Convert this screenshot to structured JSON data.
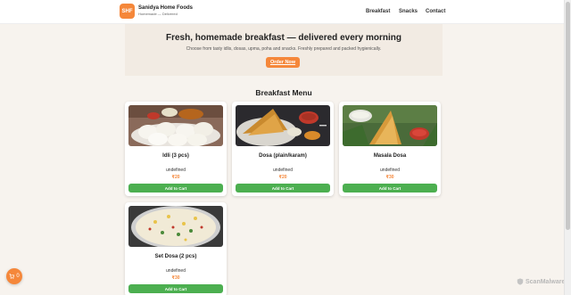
{
  "header": {
    "logo_text": "SHF",
    "brand_name": "Sanidya Home Foods",
    "brand_tagline": "Homemade — Delivered",
    "nav": [
      "Breakfast",
      "Snacks",
      "Contact"
    ]
  },
  "hero": {
    "title": "Fresh, homemade breakfast — delivered every morning",
    "subtitle": "Choose from tasty idlis, dosas, upma, poha and snacks. Freshly prepared and packed hygienically.",
    "cta": "Order Now"
  },
  "menu": {
    "title": "Breakfast Menu",
    "add_label": "Add to Cart",
    "items": [
      {
        "name": "Idli (3 pcs)",
        "desc": "undefined",
        "price": "₹20"
      },
      {
        "name": "Dosa (plain/karam)",
        "desc": "undefined",
        "price": "₹20"
      },
      {
        "name": "Masala Dosa",
        "desc": "undefined",
        "price": "₹30"
      },
      {
        "name": "Set Dosa (2 pcs)",
        "desc": "undefined",
        "price": "₹30"
      }
    ]
  },
  "cart": {
    "count": "0"
  },
  "watermark": "ScanMalware",
  "colors": {
    "accent": "#f5873a",
    "button_green": "#4caf50",
    "hero_bg": "#f2ebe3"
  }
}
